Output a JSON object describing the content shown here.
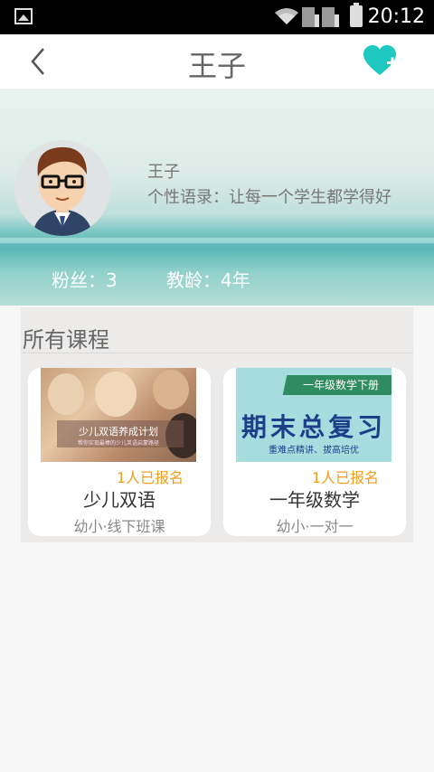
{
  "status_bar": {
    "time": "20:12"
  },
  "header": {
    "title": "王子",
    "back_icon": "chevron-left-icon",
    "follow_icon": "heart-plus-icon",
    "accent": "#1fc8c0"
  },
  "profile": {
    "name": "王子",
    "motto": "个性语录：让每一个学生都学得好",
    "fans": "粉丝：3",
    "teaching_years": "教龄：4年"
  },
  "courses": {
    "section_title": "所有课程",
    "items": [
      {
        "enrolled": "1人已报名",
        "name": "少儿双语",
        "type": "幼小·线下班课",
        "image_title": "少儿双语养成计划",
        "image_subtitle": "帮你实现最棒的少儿英语启蒙路径"
      },
      {
        "enrolled": "1人已报名",
        "name": "一年级数学",
        "type": "幼小·一对一",
        "image_ribbon": "一年级数学下册",
        "image_title": "期末总复习",
        "image_subtitle": "重难点精讲、拔高培优"
      }
    ]
  }
}
